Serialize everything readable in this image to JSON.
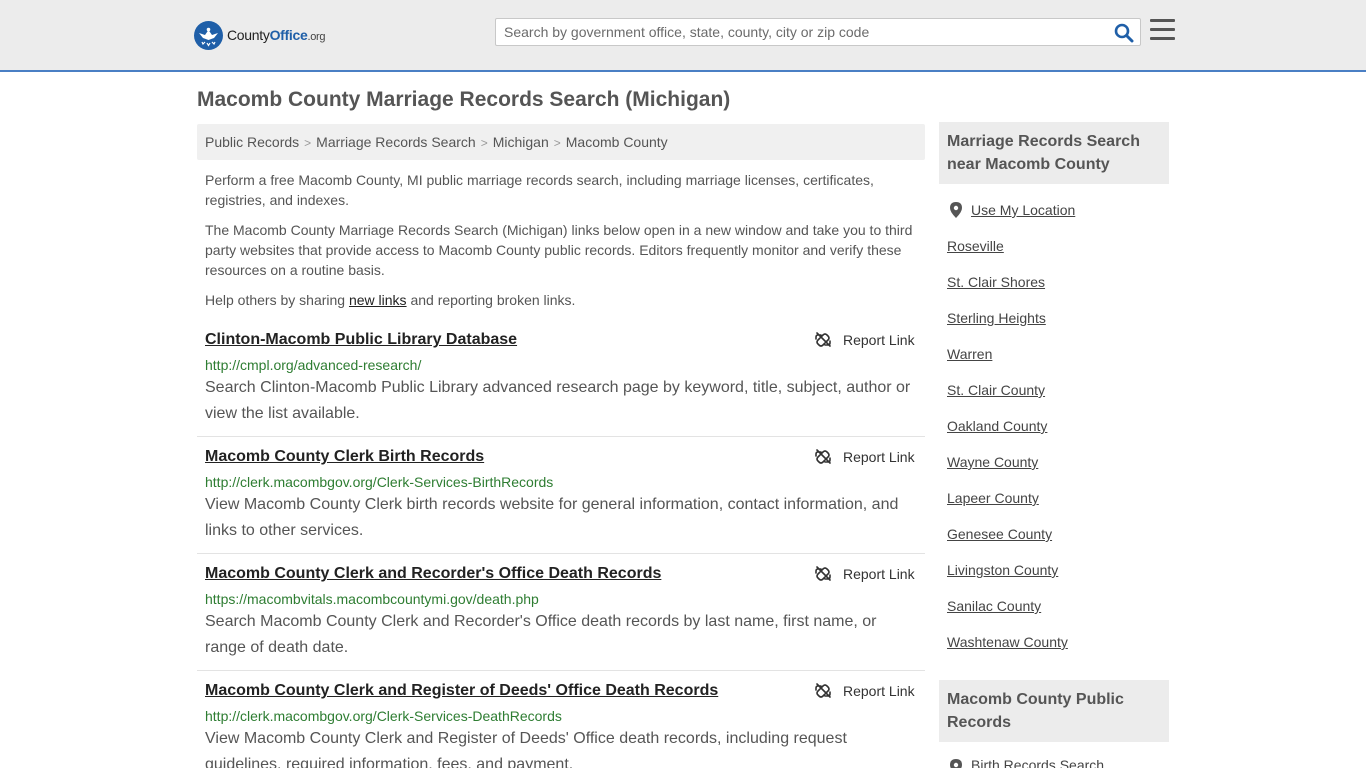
{
  "header": {
    "logo": {
      "brand_prefix": "County",
      "brand_main": "Office",
      "brand_tld": ".org"
    },
    "search_placeholder": "Search by government office, state, county, city or zip code",
    "colors": {
      "bar_bg": "#ececec",
      "accent": "#1f5fa8",
      "bottom_rule": "#4a7fc4"
    },
    "icons": {
      "search": "search-icon",
      "menu": "hamburger-menu-icon",
      "logo": "eagle-seal-icon"
    }
  },
  "page_title": "Macomb County Marriage Records Search (Michigan)",
  "breadcrumb": [
    "Public Records",
    "Marriage Records Search",
    "Michigan",
    "Macomb County"
  ],
  "intro": {
    "p1": "Perform a free Macomb County, MI public marriage records search, including marriage licenses, certificates, registries, and indexes.",
    "p2": "The Macomb County Marriage Records Search (Michigan) links below open in a new window and take you to third party websites that provide access to Macomb County public records. Editors frequently monitor and verify these resources on a routine basis.",
    "p3_before": "Help others by sharing ",
    "p3_link": "new links",
    "p3_after": " and reporting broken links."
  },
  "report_label": "Report Link",
  "records": [
    {
      "title": "Clinton-Macomb Public Library Database",
      "url": "http://cmpl.org/advanced-research/",
      "description": "Search Clinton-Macomb Public Library advanced research page by keyword, title, subject, author or view the list available."
    },
    {
      "title": "Macomb County Clerk Birth Records",
      "url": "http://clerk.macombgov.org/Clerk-Services-BirthRecords",
      "description": "View Macomb County Clerk birth records website for general information, contact information, and links to other services."
    },
    {
      "title": "Macomb County Clerk and Recorder's Office Death Records",
      "url": "https://macombvitals.macombcountymi.gov/death.php",
      "description": "Search Macomb County Clerk and Recorder's Office death records by last name, first name, or range of death date."
    },
    {
      "title": "Macomb County Clerk and Register of Deeds' Office Death Records",
      "url": "http://clerk.macombgov.org/Clerk-Services-DeathRecords",
      "description": "View Macomb County Clerk and Register of Deeds' Office death records, including request guidelines, required information, fees, and payment."
    }
  ],
  "sidebar": {
    "nearby_heading": "Marriage Records Search near Macomb County",
    "use_location": "Use My Location",
    "nearby_links": [
      "Roseville",
      "St. Clair Shores",
      "Sterling Heights",
      "Warren",
      "St. Clair County",
      "Oakland County",
      "Wayne County",
      "Lapeer County",
      "Genesee County",
      "Livingston County",
      "Sanilac County",
      "Washtenaw County"
    ],
    "public_heading": "Macomb County Public Records",
    "public_links": [
      "Birth Records Search"
    ]
  }
}
